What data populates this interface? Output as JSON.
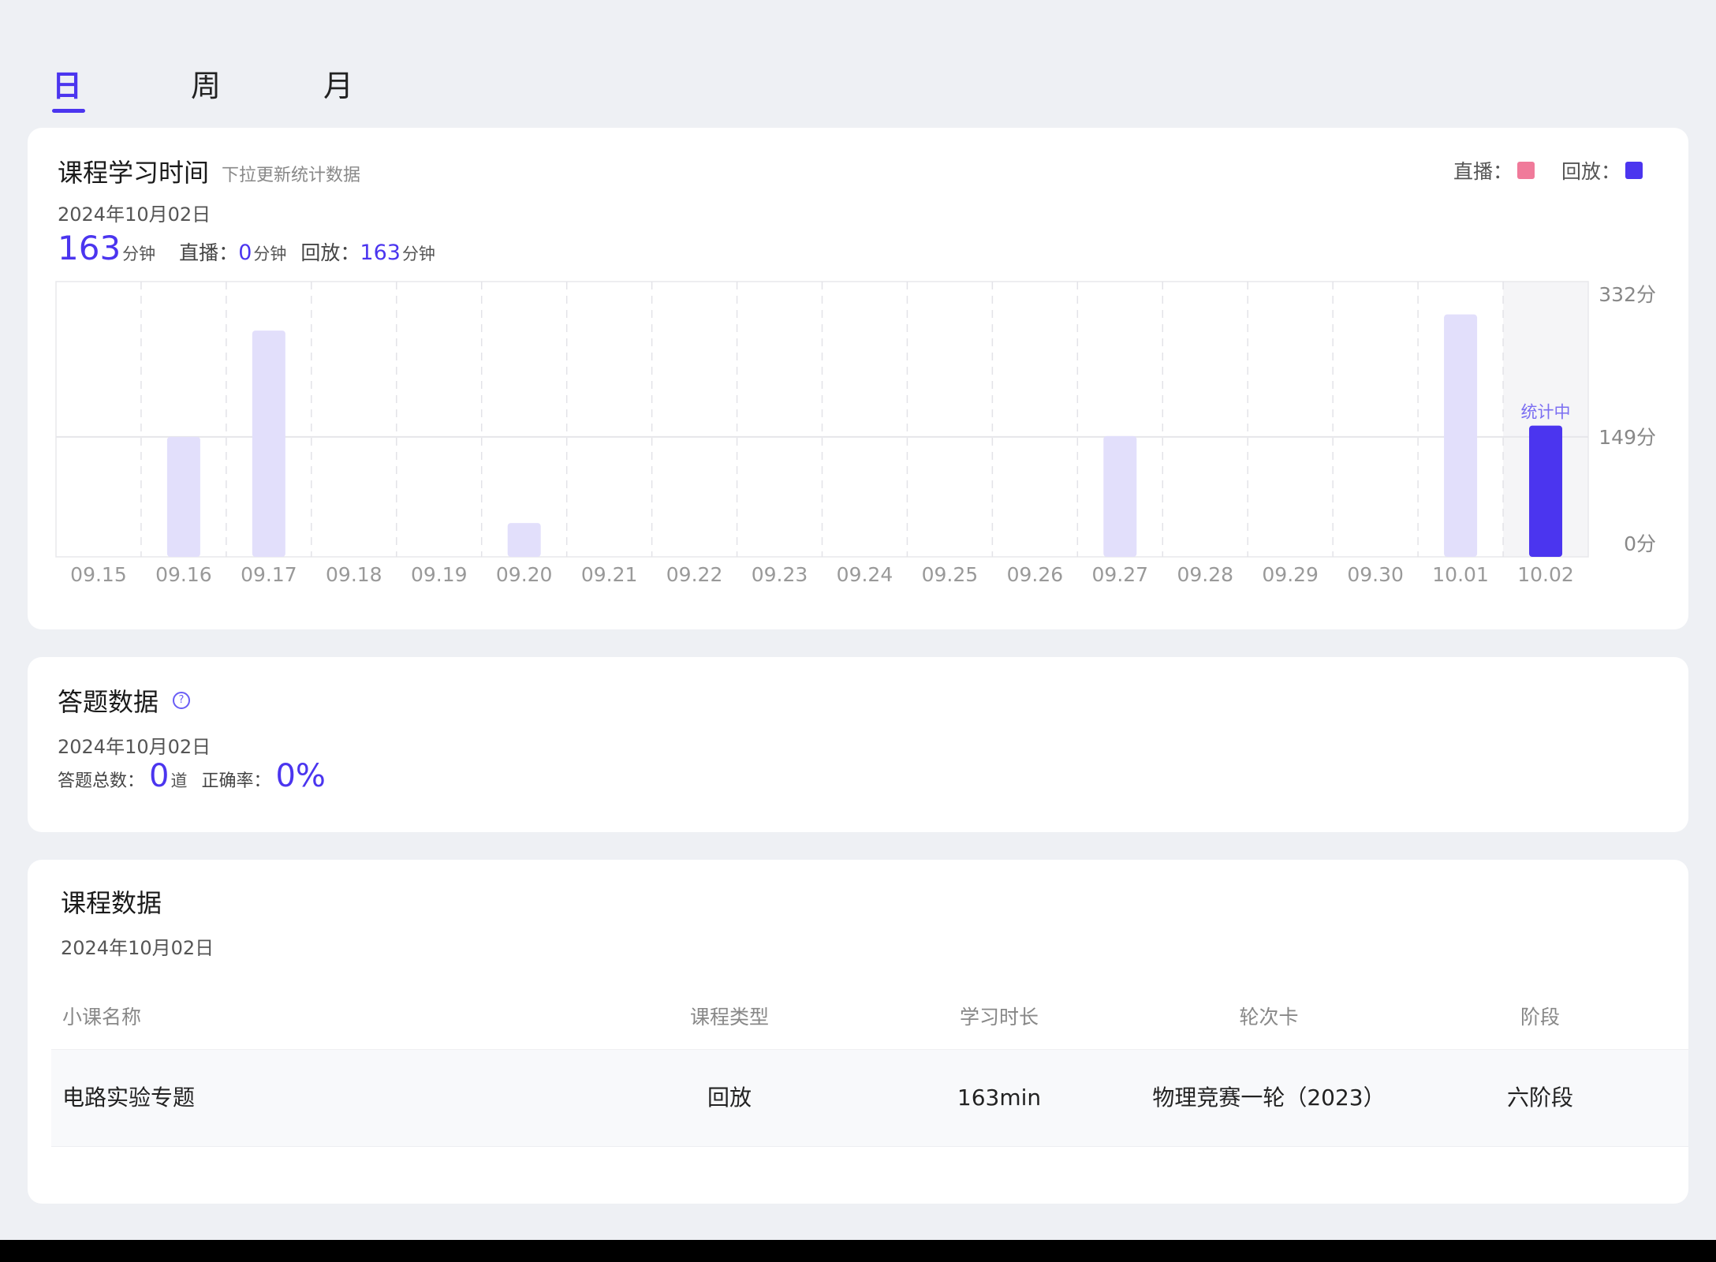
{
  "tabs": [
    {
      "label": "日",
      "active": true
    },
    {
      "label": "周",
      "active": false
    },
    {
      "label": "月",
      "active": false
    }
  ],
  "study_time": {
    "title": "课程学习时间",
    "subtitle": "下拉更新统计数据",
    "date": "2024年10月02日",
    "total": "163",
    "total_unit": "分钟",
    "live_label": "直播：",
    "live_value": "0",
    "live_unit": "分钟",
    "replay_label": "回放：",
    "replay_value": "163",
    "replay_unit": "分钟",
    "legend": [
      {
        "label": "直播：",
        "color": "#f07a9a"
      },
      {
        "label": "回放：",
        "color": "#4b35ef"
      }
    ],
    "counting_label": "统计中"
  },
  "chart_data": {
    "type": "bar",
    "categories": [
      "09.15",
      "09.16",
      "09.17",
      "09.18",
      "09.19",
      "09.20",
      "09.21",
      "09.22",
      "09.23",
      "09.24",
      "09.25",
      "09.26",
      "09.27",
      "09.28",
      "09.29",
      "09.30",
      "10.01",
      "10.02"
    ],
    "values": [
      0,
      149,
      281,
      0,
      0,
      42,
      0,
      0,
      0,
      0,
      0,
      0,
      150,
      0,
      0,
      0,
      301,
      163
    ],
    "yticks": [
      "332分",
      "149分",
      "0分"
    ],
    "ylim": [
      0,
      332
    ],
    "highlight_index": 17,
    "bar_color": "#e2dffb",
    "highlight_color": "#4b35ef",
    "grid": true
  },
  "answer": {
    "title": "答题数据",
    "help_icon": "question-circle-icon",
    "help_glyph": "?",
    "date": "2024年10月02日",
    "total_label": "答题总数：",
    "total_value": "0",
    "total_unit": "道",
    "accuracy_label": "正确率：",
    "accuracy_value": "0%"
  },
  "course": {
    "title": "课程数据",
    "date": "2024年10月02日",
    "columns": [
      "小课名称",
      "课程类型",
      "学习时长",
      "轮次卡",
      "阶段"
    ],
    "rows": [
      [
        "电路实验专题",
        "回放",
        "163min",
        "物理竞赛一轮（2023）",
        "六阶段"
      ]
    ]
  }
}
